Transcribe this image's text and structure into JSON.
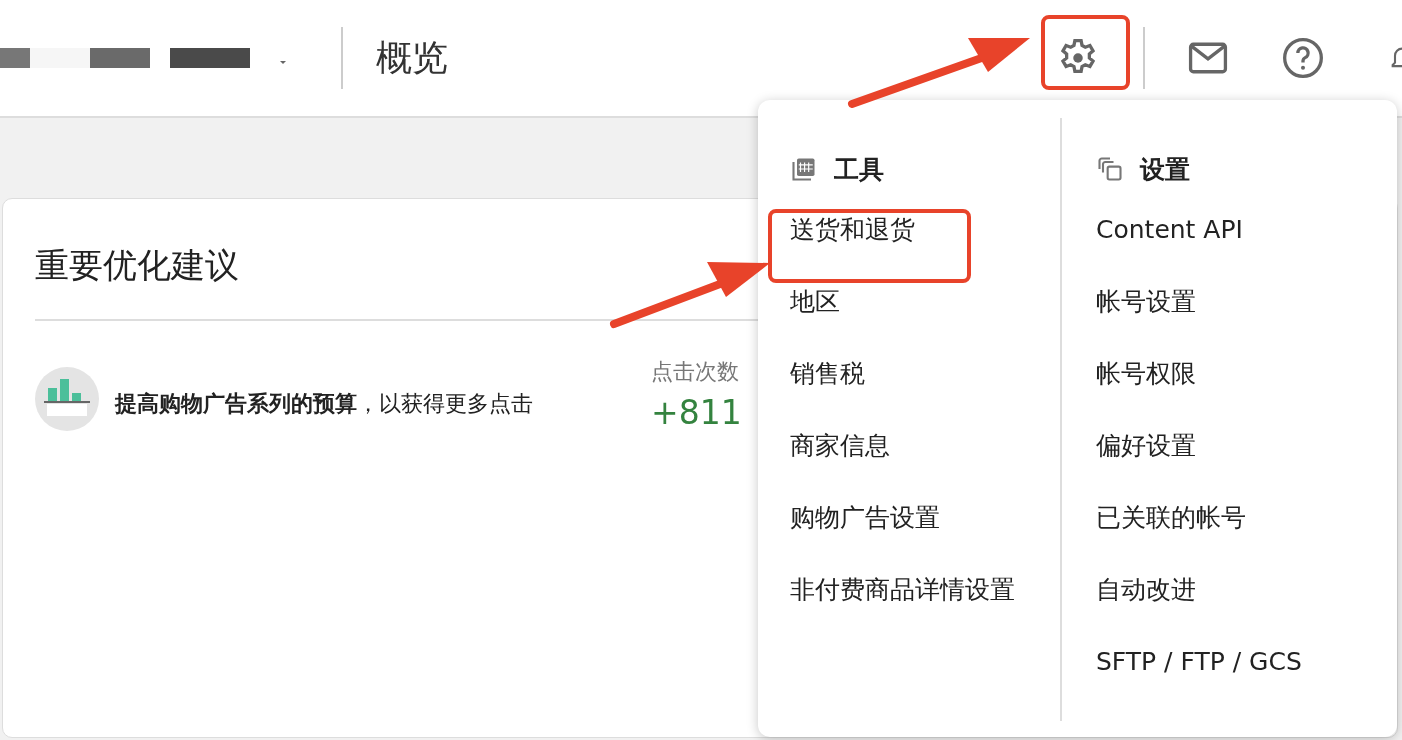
{
  "header": {
    "page_title": "概览"
  },
  "card": {
    "title": "重要优化建议",
    "recommendation": {
      "text": "**提高购物广告系列的预算**，以获得更多点击",
      "metric_label": "点击次数",
      "metric_value": "+811"
    }
  },
  "menu": {
    "columns": [
      {
        "kind": "tools",
        "heading": "工具",
        "items": [
          "送货和退货",
          "地区",
          "销售税",
          "商家信息",
          "购物广告设置",
          "非付费商品详情设置"
        ]
      },
      {
        "kind": "settings",
        "heading": "设置",
        "items": [
          "Content API",
          "帐号设置",
          "帐号权限",
          "偏好设置",
          "已关联的帐号",
          "自动改进",
          "SFTP / FTP / GCS"
        ]
      }
    ]
  }
}
